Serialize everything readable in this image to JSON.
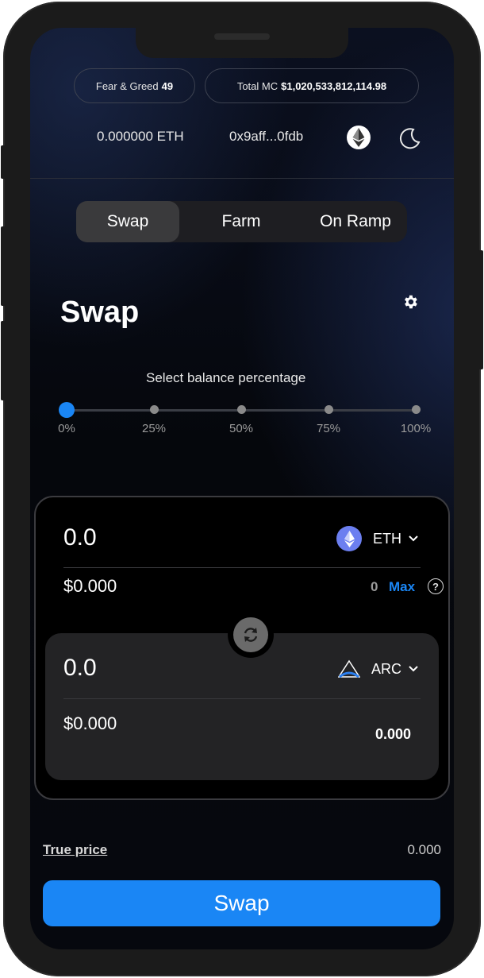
{
  "header": {
    "fear_greed_label": "Fear & Greed",
    "fear_greed_value": "49",
    "total_mc_label": "Total MC",
    "total_mc_value": "$1,020,533,812,114.98",
    "balance": "0.000000 ETH",
    "address": "0x9aff...0fdb",
    "network_icon": "ethereum-icon",
    "theme_icon": "moon-icon"
  },
  "tabs": [
    {
      "label": "Swap",
      "active": true
    },
    {
      "label": "Farm",
      "active": false
    },
    {
      "label": "On Ramp",
      "active": false
    }
  ],
  "page": {
    "title": "Swap",
    "settings_icon": "gear-icon",
    "slider_label": "Select balance percentage",
    "slider_stops": [
      "0%",
      "25%",
      "50%",
      "75%",
      "100%"
    ],
    "slider_value": 0
  },
  "from": {
    "amount": "0.0",
    "usd": "$0.000",
    "token": "ETH",
    "balance": "0",
    "max_label": "Max",
    "help": "?"
  },
  "to": {
    "amount": "0.0",
    "usd": "$0.000",
    "token": "ARC",
    "balance": "0.000"
  },
  "footer": {
    "true_price_label": "True price",
    "true_price_value": "0.000",
    "swap_button": "Swap"
  },
  "colors": {
    "accent": "#1a86f5",
    "background": "#05070c",
    "card": "#232325"
  }
}
